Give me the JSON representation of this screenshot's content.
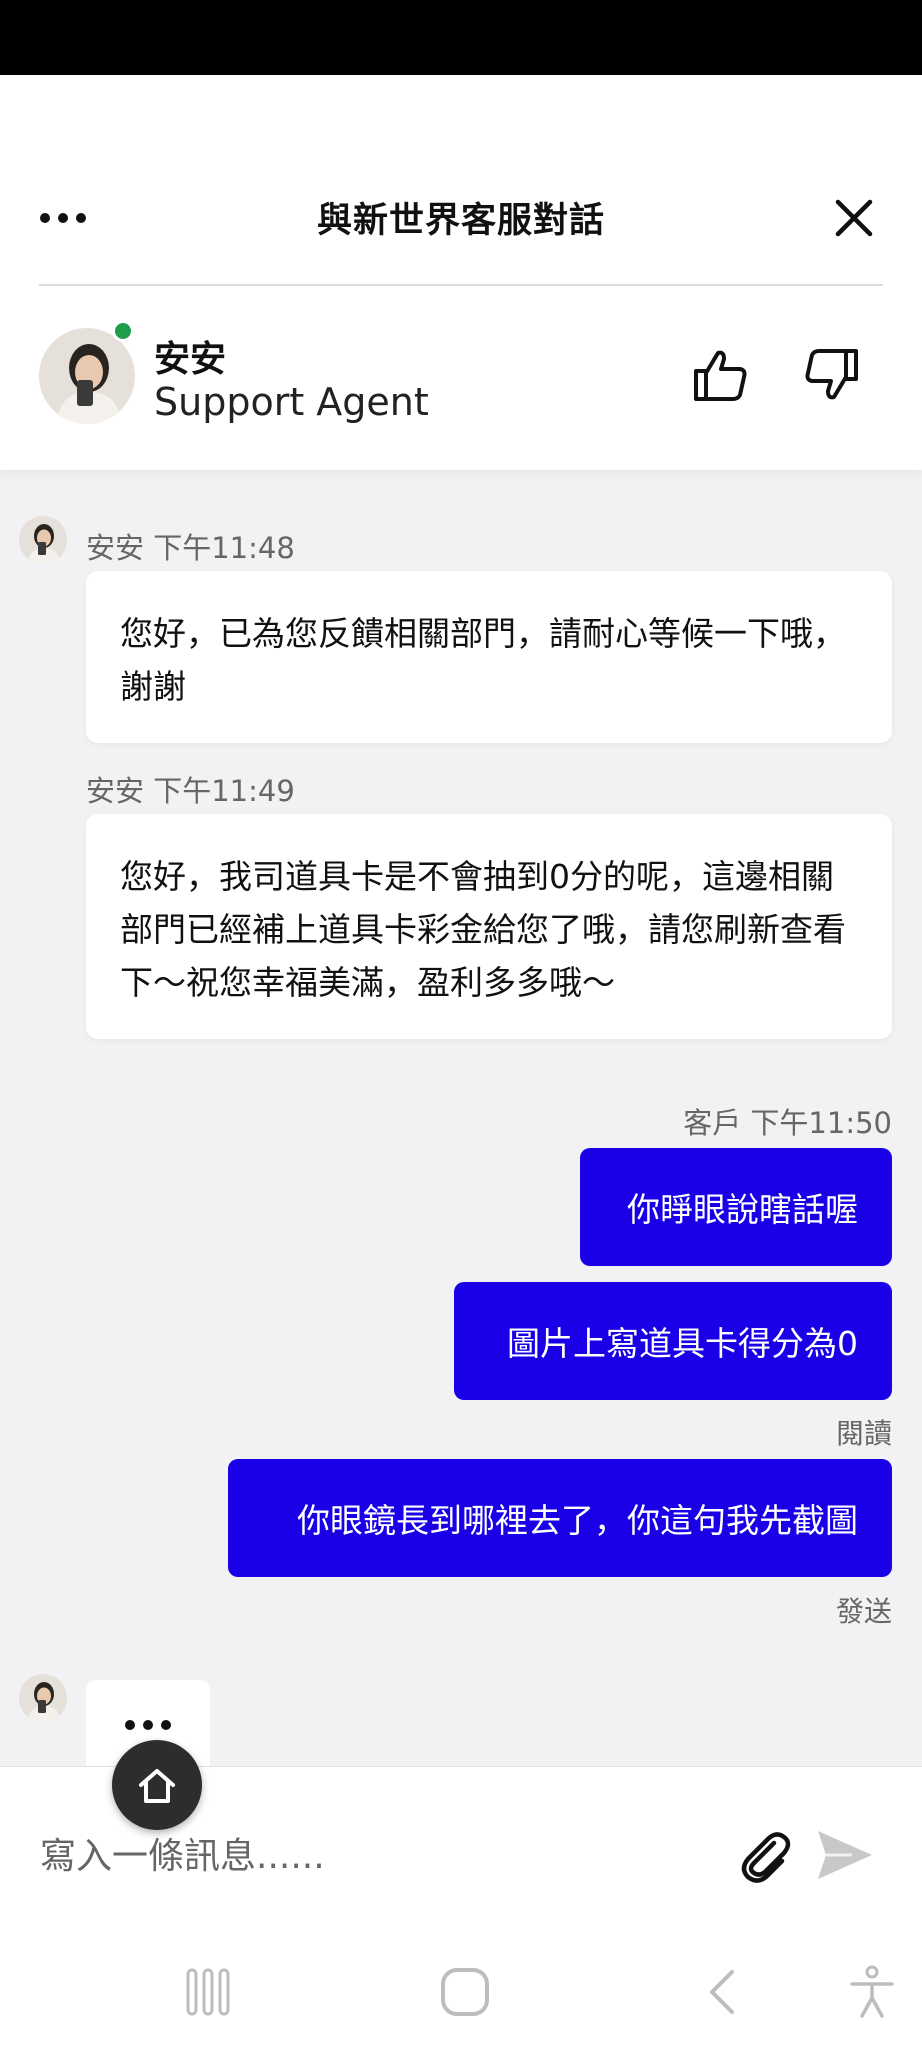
{
  "header": {
    "title": "與新世界客服對話",
    "more_icon": "more-horizontal-icon",
    "close_icon": "close-icon"
  },
  "agent": {
    "name": "安安",
    "role": "Support Agent",
    "status": "online",
    "status_color": "#1f9d4a"
  },
  "messages": [
    {
      "sender": "安安",
      "time": "下午11:48",
      "text": "您好，已為您反饋相關部門，請耐心等候一下哦，謝謝"
    },
    {
      "sender": "安安",
      "time": "下午11:49",
      "text": "您好，我司道具卡是不會抽到0分的呢，這邊相關部門已經補上道具卡彩金給您了哦，請您刷新查看下～祝您幸福美滿，盈利多多哦～"
    },
    {
      "sender": "客戶",
      "time": "下午11:50",
      "text": "你睜眼說瞎話喔"
    },
    {
      "sender": "客戶",
      "text": "圖片上寫道具卡得分為0",
      "status": "閱讀"
    },
    {
      "sender": "客戶",
      "text": "你眼鏡長到哪裡去了，你這句我先截圖",
      "status": "發送"
    }
  ],
  "composer": {
    "placeholder": "寫入一條訊息......",
    "value": ""
  },
  "colors": {
    "outgoing_bubble": "#1a00e6",
    "incoming_bubble": "#ffffff",
    "background": "#f2f2f4"
  },
  "icons": {
    "rating_up": "thumbs-up-icon",
    "rating_down": "thumbs-down-icon",
    "attach": "paperclip-icon",
    "send": "send-icon",
    "home": "home-icon",
    "nav_recents": "recents-icon",
    "nav_home": "android-home-icon",
    "nav_back": "back-icon",
    "nav_accessibility": "accessibility-icon"
  }
}
